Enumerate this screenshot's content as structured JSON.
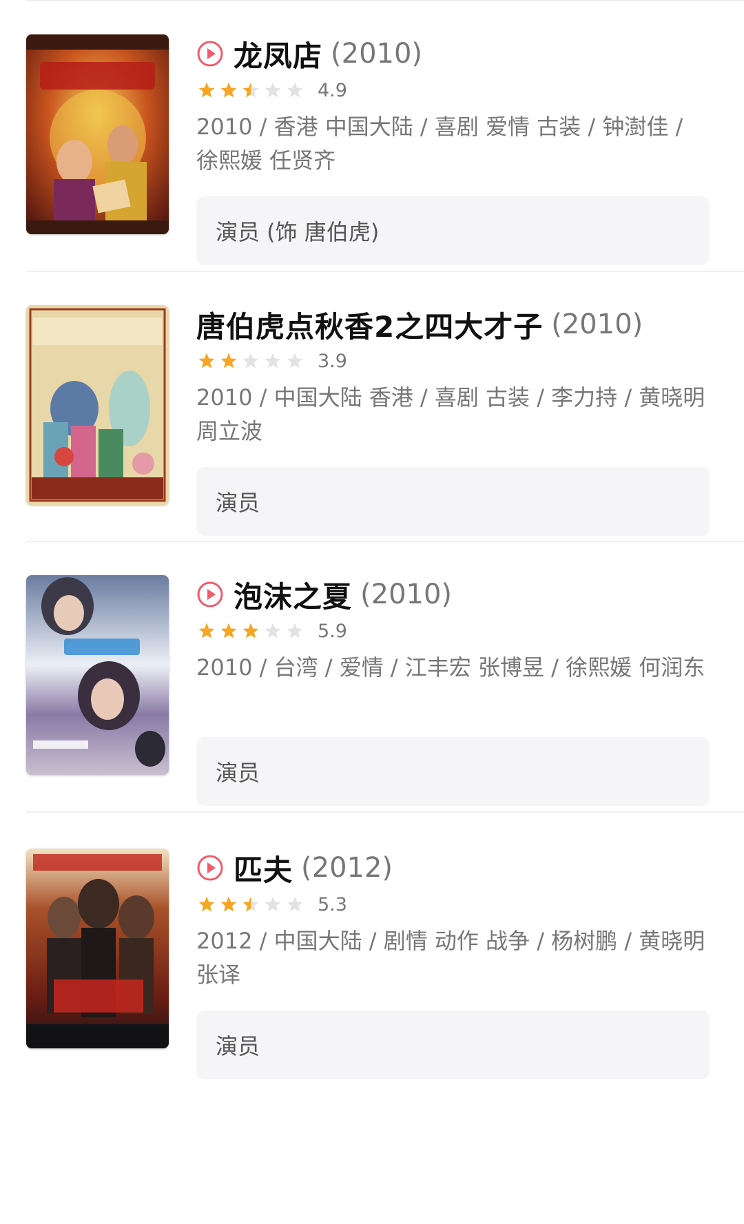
{
  "colors": {
    "star_on": "#f6a623",
    "star_off": "#e2e2e2",
    "play": "#f15b6c",
    "role_bg": "#f5f5f7"
  },
  "movies": [
    {
      "title": "龙凤店",
      "year": "(2010)",
      "has_play_icon": true,
      "rating": 4.9,
      "score": "4.9",
      "meta": "2010 / 香港 中国大陆 / 喜剧 爱情 古装 / 钟澍佳 / 徐熙媛 任贤齐",
      "role": "演员 (饰 唐伯虎)"
    },
    {
      "title": "唐伯虎点秋香2之四大才子",
      "year": "(2010)",
      "has_play_icon": false,
      "rating": 3.9,
      "score": "3.9",
      "meta": "2010 / 中国大陆 香港 / 喜剧 古装 / 李力持 / 黄晓明 周立波",
      "role": "演员"
    },
    {
      "title": "泡沫之夏",
      "year": "(2010)",
      "has_play_icon": true,
      "rating": 5.9,
      "score": "5.9",
      "meta": "2010 / 台湾 / 爱情 / 江丰宏 张博昱 / 徐熙媛 何润东",
      "role": "演员"
    },
    {
      "title": "匹夫",
      "year": "(2012)",
      "has_play_icon": true,
      "rating": 5.3,
      "score": "5.3",
      "meta": "2012 / 中国大陆 / 剧情 动作 战争 / 杨树鹏 / 黄晓明 张译",
      "role": "演员"
    }
  ]
}
